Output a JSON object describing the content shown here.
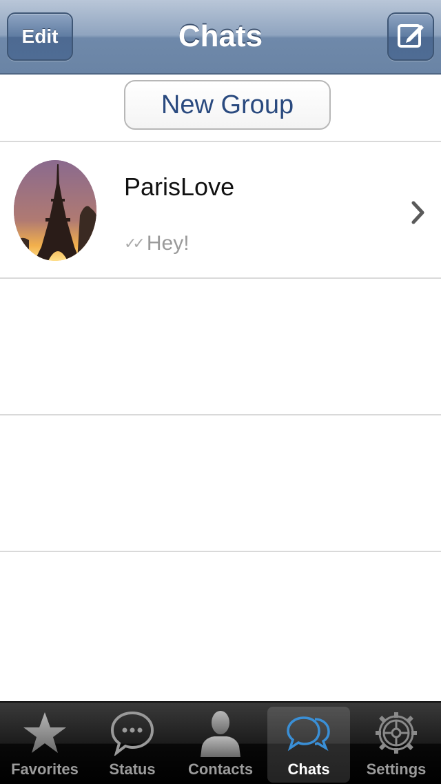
{
  "nav": {
    "title": "Chats",
    "edit_label": "Edit",
    "compose_icon": "compose-icon"
  },
  "new_group": {
    "label": "New Group"
  },
  "chats": [
    {
      "name": "ParisLove",
      "preview": "Hey!",
      "status_icon": "double-check-icon",
      "avatar": "eiffel-tower-photo"
    }
  ],
  "tabs": [
    {
      "label": "Favorites",
      "icon": "star-icon",
      "active": false
    },
    {
      "label": "Status",
      "icon": "speech-bubble-icon",
      "active": false
    },
    {
      "label": "Contacts",
      "icon": "person-icon",
      "active": false
    },
    {
      "label": "Chats",
      "icon": "chat-bubbles-icon",
      "active": true
    },
    {
      "label": "Settings",
      "icon": "gear-icon",
      "active": false
    }
  ],
  "colors": {
    "nav_bar": "#7b92b2",
    "new_group_text": "#2a4a7f",
    "tab_active_icon": "#3a8fd6"
  }
}
